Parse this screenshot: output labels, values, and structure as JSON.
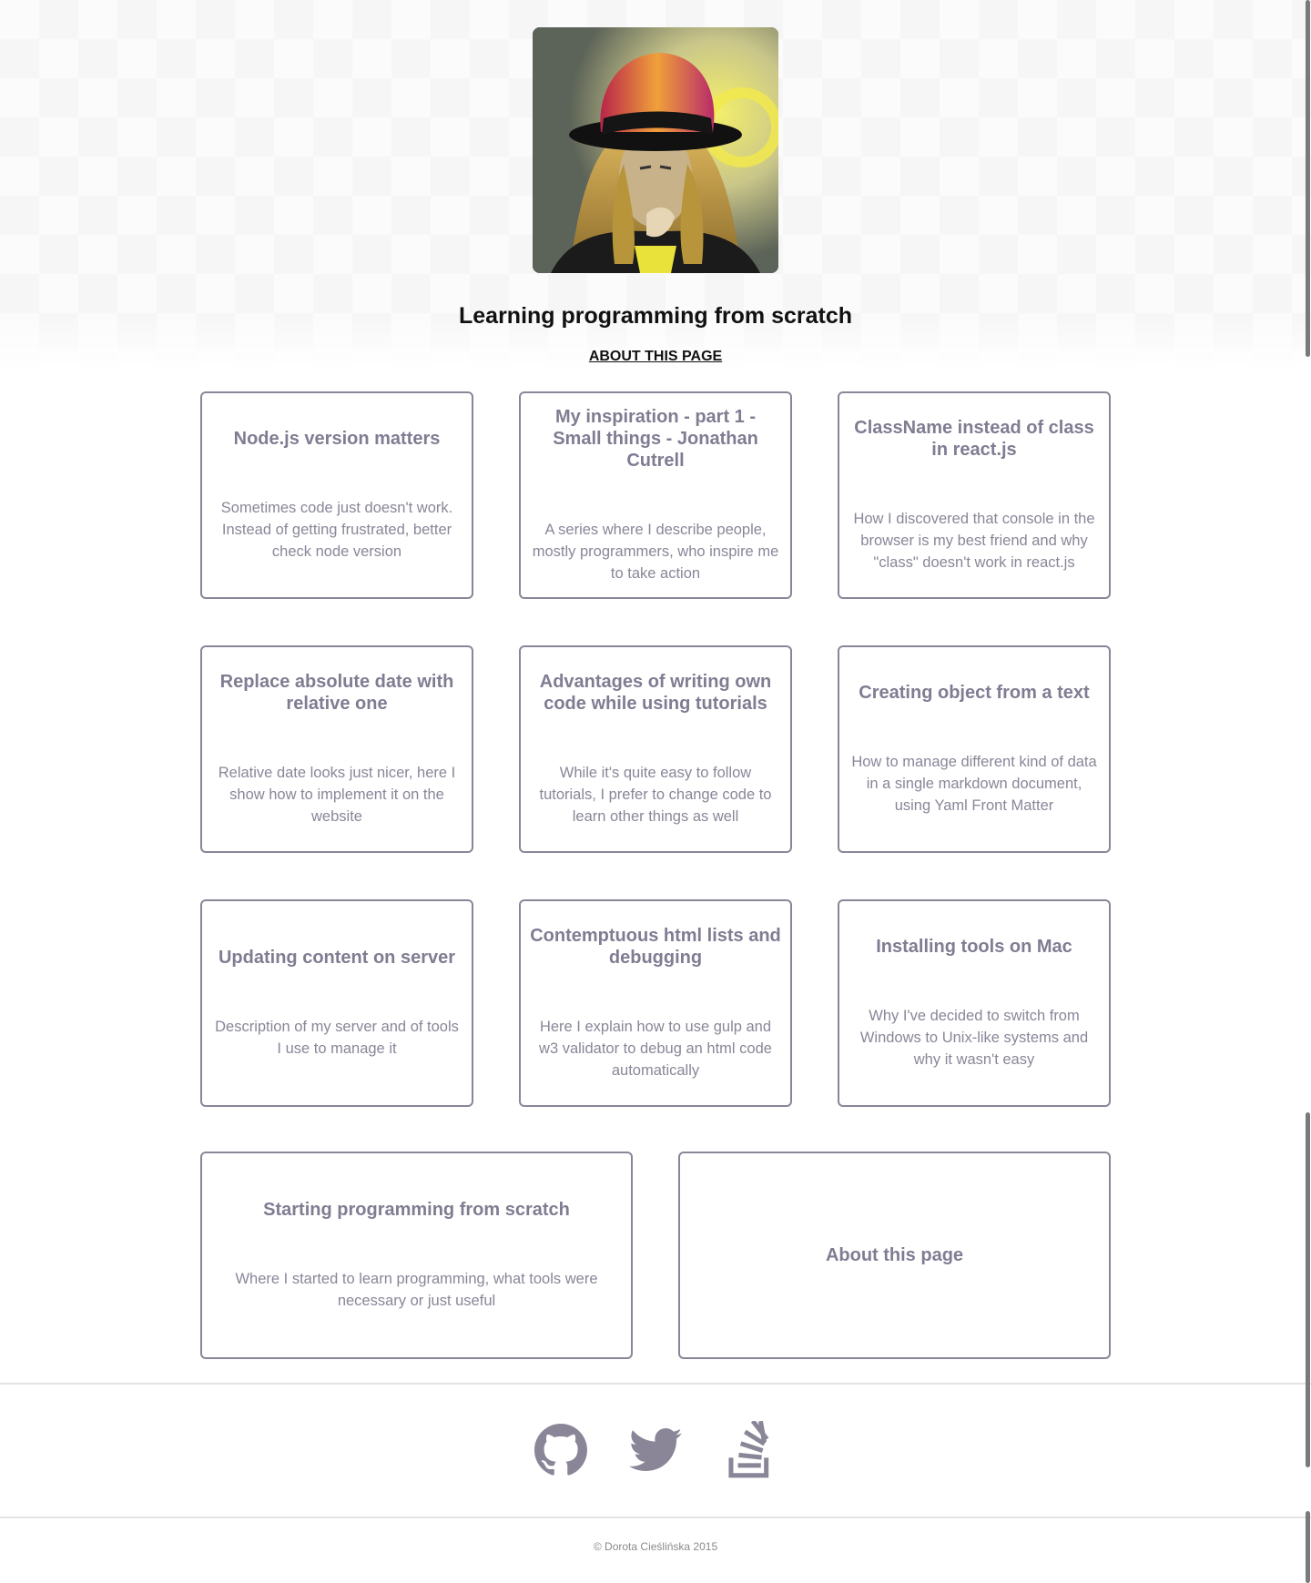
{
  "header": {
    "avatar_alt": "Portrait illustration",
    "site_title": "Learning programming from scratch",
    "about_link": "ABOUT THIS PAGE"
  },
  "cards": [
    {
      "title": "Node.js version matters",
      "description": "Sometimes code just doesn't work. Instead of getting frustrated, better check node version"
    },
    {
      "title": "My inspiration - part 1 - Small things - Jonathan Cutrell",
      "description": "A series where I describe people, mostly programmers, who inspire me to take action"
    },
    {
      "title": "ClassName instead of class in react.js",
      "description": "How I discovered that console in the browser is my best friend and why \"class\" doesn't work in react.js"
    },
    {
      "title": "Replace absolute date with relative one",
      "description": "Relative date looks just nicer, here I show how to implement it on the website"
    },
    {
      "title": "Advantages of writing own code while using tutorials",
      "description": "While it's quite easy to follow tutorials, I prefer to change code to learn other things as well"
    },
    {
      "title": "Creating object from a text",
      "description": "How to manage different kind of data in a single markdown document, using Yaml Front Matter"
    },
    {
      "title": "Updating content on server",
      "description": "Description of my server and of tools I use to manage it"
    },
    {
      "title": "Contemptuous html lists and debugging",
      "description": "Here I explain how to use gulp and w3 validator to debug an html code automatically"
    },
    {
      "title": "Installing tools on Mac",
      "description": "Why I've decided to switch from Windows to Unix-like systems and why it wasn't easy"
    }
  ],
  "wide_cards": [
    {
      "title": "Starting programming from scratch",
      "description": "Where I started to learn programming, what tools were necessary or just useful"
    },
    {
      "title": "About this page",
      "description": ""
    }
  ],
  "footer": {
    "social_icons": [
      "github-icon",
      "twitter-icon",
      "stackoverflow-icon"
    ],
    "icon_color": "#8a8698",
    "copyright": "© Dorota Cieślińska 2015"
  },
  "colors": {
    "card_border": "#8a8698",
    "card_text": "#8a8698",
    "title_text": "#111111"
  }
}
